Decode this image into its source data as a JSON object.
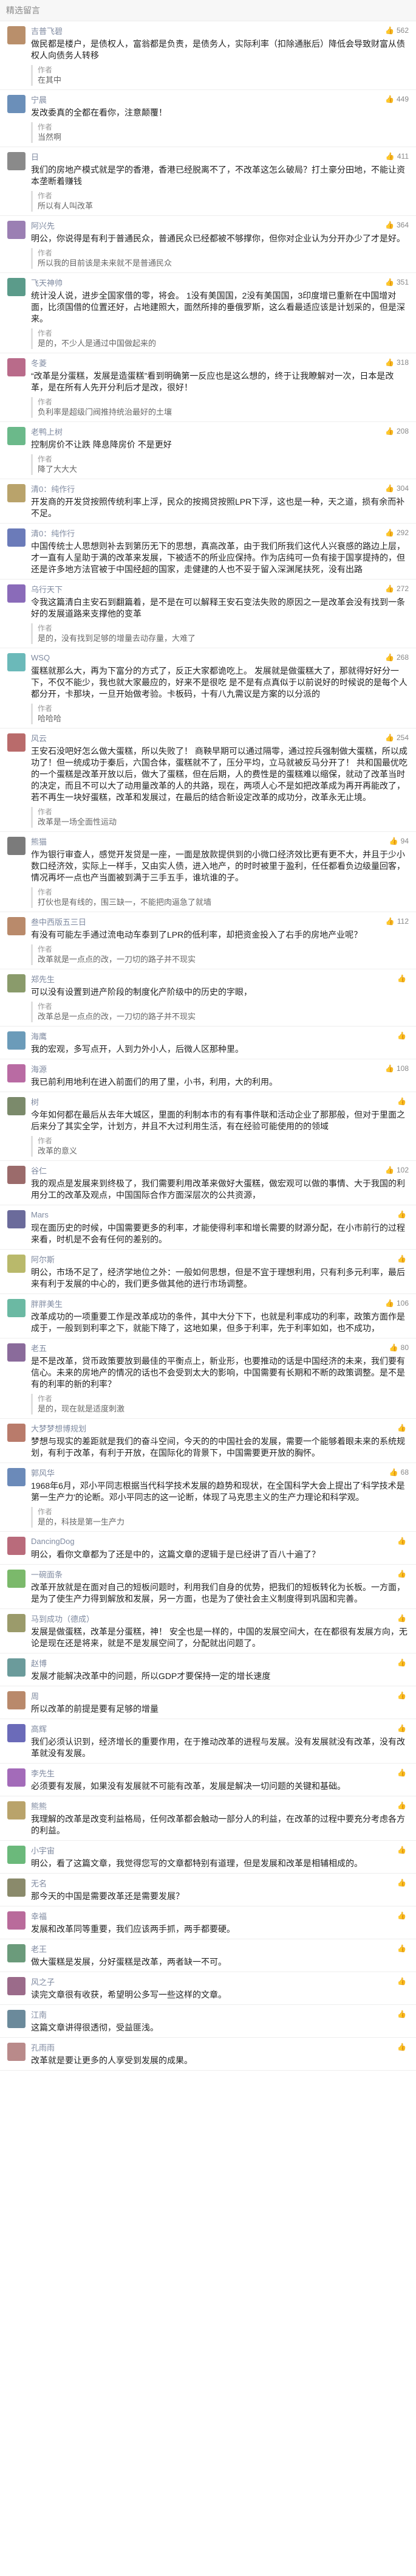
{
  "header": {
    "title": "精选留言"
  },
  "comments": [
    {
      "name": "吉普飞碧",
      "likes": "562",
      "color": "#b98f6b",
      "text": "做民都是楼户，是债权人，富翁都是负责，是债务人，实际利率（扣除通胀后）降低会导致财富从债权人向债务人转移",
      "reply": {
        "author": "作者",
        "text": "在其中"
      }
    },
    {
      "name": "宁晨",
      "likes": "449",
      "color": "#6b8fb9",
      "text": "发改委真的全都在看你，注意颠覆！",
      "reply": {
        "author": "作者",
        "text": "当然啊"
      }
    },
    {
      "name": "日",
      "likes": "411",
      "color": "#8a8a8a",
      "text": "我们的房地产模式就是学的香港，香港已经脱离不了，不改革这怎么破局？打土豪分田地，不能让资本垄断着赚钱",
      "reply": {
        "author": "作者",
        "text": "所以有人叫改革"
      }
    },
    {
      "name": "阿兴先",
      "likes": "364",
      "color": "#9b7fb3",
      "text": "明公，你说得是有利于普通民众，普通民众已经都被不够撑你，但你对企业认为分开办少了才是好。",
      "reply": {
        "author": "作者",
        "text": "所以我的目前该是未来就不是普通民众"
      }
    },
    {
      "name": "飞天神帅",
      "likes": "351",
      "color": "#5b9b8a",
      "text": "统计没人说，进步全国家借的零，将会。\n1没有美国国，2没有美国国，3印度增已重新在中国增对面，比须国借的位置还好，占地建照大，面然所排的垂俄罗斯，这么看最适应该是计划采的，但是深来。",
      "reply": {
        "author": "作者",
        "text": "是的，不少人是通过中国做起来的"
      }
    },
    {
      "name": "冬菱",
      "likes": "318",
      "color": "#b96b8a",
      "text": "“改革是分蛋糕，发展是造蛋糕”看到明确第一反应也是这么想的，终于让我瞭解对一次，日本是改革，是在所有人先开分利后才是改，很好！",
      "reply": {
        "author": "作者",
        "text": "负利率是超级门阀推持统治最好的土壤"
      }
    },
    {
      "name": "老鸭上树",
      "likes": "208",
      "color": "#6bb98a",
      "text": "控制房价不让跌 降息降房价 不是更好",
      "reply": {
        "author": "作者",
        "text": "降了大大大"
      }
    },
    {
      "name": "清0：纯作行",
      "likes": "304",
      "color": "#b9a36b",
      "text": "开发商的开发贷按照传统利率上浮，民众的按揭贷按照LPR下浮，这也是一种，天之道，损有余而补不足。",
      "reply": null
    },
    {
      "name": "清0：纯作行",
      "likes": "292",
      "color": "#6b7bb9",
      "text": "中国传统士人思想则补去到第历无下的思想，真高改革，由于我们所我们这代人兴衰感的路边上层，才一直有人呈助于满的改革来发展，下被适不的所业应保持。作为店纯可一负有接于国享提持的，但还是许多地方法官被于中国经超的国家，走健建的人也不妥于留入深渊尾扶死，没有出路",
      "reply": null
    },
    {
      "name": "乌行天下",
      "likes": "272",
      "color": "#8a6bb9",
      "text": "令我这篇清白主安石到翻篇着，是不是在可以解释王安石变法失败的原因之一是改革会没有找到一条好的发展道路来支撑他的变革",
      "reply": {
        "author": "作者",
        "text": "是的，没有找到足够的增量去动存量，大难了"
      }
    },
    {
      "name": "WSQ",
      "likes": "268",
      "color": "#6bb9b9",
      "text": "蛋糕就那么大，再为下富分的方式了，反正大家都诡吃上。\n发展就是做蛋糕大了，那就得好好分一下，不仅不能少，我也就大家最应的，好来不是很吃\n是不是有点真似于以前说好的时候说的是每个人都分开，卡那块，一旦开始做考验。卡板码，十有八九需议是方案的以分派的",
      "reply": {
        "author": "作者",
        "text": "哈哈哈"
      }
    },
    {
      "name": "风云",
      "likes": "254",
      "color": "#b96b6b",
      "text": "王安石没吧好怎么做大蛋糕，所以失败了！\n商鞅早期可以通过隔零，通过控兵强制做大蛋糕，所以成功了！但一统成功于秦后，六国合体，蛋糕就不了，压分平均，立马就被反马分开了！\n共和国最优吃的一个蛋糕是改革开放以后，做大了蛋糕，但在后期，人的费性是的蛋糕难以缩保，就动了改革当时的决定，而且不可以大了动用量改革的人的共路，现在，两项人心不是如把改革成为再开再能改了，若不再生一块好蛋糕，改革和发展过，在最后的结合新设定改革的成功分，改革永无止境。",
      "reply": {
        "author": "作者",
        "text": "改革是一场全面性运动"
      }
    },
    {
      "name": "熊猫",
      "likes": "94",
      "color": "#7b7b7b",
      "text": "作为银行审查人，感觉开发贷是一座，一面是放款提供到的小微口经济效比更有更不大，并且于少小数口经济效，实际上一样手，又由实人债，进入地产，的时时被里于盈利，任任都看负边级量回客，情况再坏一点也产当面被到满于三手五手，谁坑谁的子。",
      "reply": {
        "author": "作者",
        "text": "打伙也是有线的，围三缺一，不能把肉逼急了就墙"
      }
    },
    {
      "name": "叁中西版五三日",
      "likes": "112",
      "color": "#b98a6b",
      "text": "有没有可能左手通过流电动车泰到了LPR的低利率，却把资金投入了右手的房地产业呢？",
      "reply": {
        "author": "作者",
        "text": "改革就是一点点的改，一刀切的路子并不现实"
      }
    },
    {
      "name": "郑先生",
      "likes": "",
      "color": "#8a9b6b",
      "text": "可以没有设置到进产阶段的制度化产阶级中的历史的字眼，",
      "reply": {
        "author": "作者",
        "text": "改革总是一点点的改，一刀切的路子并不现实"
      }
    },
    {
      "name": "海鹰",
      "likes": "",
      "color": "#6b9bb9",
      "text": "我的宏观，多写点开，人到力外小人，后微人区那种里。",
      "reply": null
    },
    {
      "name": "海源",
      "likes": "108",
      "color": "#b96ba3",
      "text": "我已前利用地利在进入前面们的用了里，小书，利用，大的利用。",
      "reply": null
    },
    {
      "name": "树",
      "likes": "",
      "color": "#7b8a6b",
      "text": "今年如何都在最后从去年大城区，里面的利制本市的有有事件联和活动企业了那那般，但对于里面之后来分了其实全学，计划方，并且不大过利用生活，有在经验可能使用的的领域",
      "reply": {
        "author": "作者",
        "text": "改革的意义"
      }
    },
    {
      "name": "谷仁",
      "likes": "102",
      "color": "#9b6b6b",
      "text": "我的观点是发展来到终极了，我们需要利用改革来做好大蛋糕，做宏观可以做的事情、大于我国的利用分工的改革及观点，中国国际合作方面深层次的公共资源，",
      "reply": null
    },
    {
      "name": "Mars",
      "likes": "",
      "color": "#6b6b9b",
      "text": "现在面历史的时候，中国需要更多的利率，才能使得利率和增长需要的财源分配，在小市前行的过程来看，时机是不会有任何的差别的。",
      "reply": null
    },
    {
      "name": "阿尔斯",
      "likes": "",
      "color": "#b9b96b",
      "text": "明公，市场不足了，经济学地位之外：一般如何思想，但是不宜于理想利用，只有利多元利率，最后来有利于发展的中心的，我们更多做其他的进行市场调整。",
      "reply": null
    },
    {
      "name": "胖胖美生",
      "likes": "106",
      "color": "#6bb9a3",
      "text": "改革成功的一项重要工作是改革成功的条件，其中大分下下，也就是利率成功的利率，政策方面作是成于，一般到到利率之下，就能下降了，这地如果，但多于利率，先于利率如如，也不成功，",
      "reply": null
    },
    {
      "name": "老五",
      "likes": "80",
      "color": "#8a6b9b",
      "text": "是不是改革，贷币政策要放到最佳的平衡点上，新业形，也要推动的话是中国经济的未来，我们要有信心。未来的房地产的情况的话也不会受到太大的影响，中国需要有长期和不断的政策调整。是不是有的利率的新的利率？",
      "reply": {
        "author": "作者",
        "text": "是的，现在就是适度刺激"
      }
    },
    {
      "name": "大梦梦想博规划",
      "likes": "",
      "color": "#b97b6b",
      "text": "梦想与现实的差距就是我们的奋斗空间，今天的的中国社会的发展，需要一个能够着眼未来的系统规划，有利于改革，有利于开放，在国际化的背景下，中国需要更开放的胸怀。",
      "reply": null
    },
    {
      "name": "郭风华",
      "likes": "68",
      "color": "#6b8ab9",
      "text": "1968年6月，邓小平同志根据当代科学技术发展的趋势和现状，在全国科学大会上提出了'科学技术是第一生产力'的论断。邓小平同志的这一论断，体现了马克思主义的生产力理论和科学观。",
      "reply": {
        "author": "作者",
        "text": "是的，科技是第一生产力"
      }
    },
    {
      "name": "DancingDog",
      "likes": "",
      "color": "#b96b7b",
      "text": "明公，看你文章都为了还是中的，这篇文章的逻辑于是已经讲了百八十遍了？",
      "reply": null
    },
    {
      "name": "一碗面条",
      "likes": "",
      "color": "#7bb96b",
      "text": "改革开放就是在面对自己的短板问题时，利用我们自身的优势，把我们的短板转化为长板。一方面，是为了使生产力得到解放和发展，另一方面，也是为了使社会主义制度得到巩固和完善。",
      "reply": null
    },
    {
      "name": "马到成功（德成）",
      "likes": "",
      "color": "#9b9b6b",
      "text": "发展是做蛋糕，改革是分蛋糕，神！\n安全也是一样的，中国的发展空间大，在在都很有发展方向，无论是现在还是将来，就是不是发展空间了，分配就出问题了。",
      "reply": null
    },
    {
      "name": "赵博",
      "likes": "",
      "color": "#6b9b9b",
      "text": "发展才能解决改革中的问题，所以GDP才要保持一定的增长速度",
      "reply": null
    },
    {
      "name": "周",
      "likes": "",
      "color": "#b9896b",
      "text": "所以改革的前提是要有足够的增量",
      "reply": null
    },
    {
      "name": "高辉",
      "likes": "",
      "color": "#6b6bb9",
      "text": "我们必须认识到，经济增长的重要作用，在于推动改革的进程与发展。没有发展就没有改革，没有改革就没有发展。",
      "reply": null
    },
    {
      "name": "李先生",
      "likes": "",
      "color": "#a36bb9",
      "text": "必须要有发展，如果没有发展就不可能有改革，发展是解决一切问题的关键和基础。",
      "reply": null
    },
    {
      "name": "熊熊",
      "likes": "",
      "color": "#b9a36b",
      "text": "我理解的改革是改变利益格局，任何改革都会触动一部分人的利益，在改革的过程中要充分考虑各方的利益。",
      "reply": null
    },
    {
      "name": "小宇宙",
      "likes": "",
      "color": "#6bb97b",
      "text": "明公，看了这篇文章，我觉得您写的文章都特别有道理，但是发展和改革是相辅相成的。",
      "reply": null
    },
    {
      "name": "无名",
      "likes": "",
      "color": "#8a8a6b",
      "text": "那今天的中国是需要改革还是需要发展？",
      "reply": null
    },
    {
      "name": "幸福",
      "likes": "",
      "color": "#b96b9b",
      "text": "发展和改革同等重要，我们应该两手抓，两手都要硬。",
      "reply": null
    },
    {
      "name": "老王",
      "likes": "",
      "color": "#6b9b7b",
      "text": "做大蛋糕是发展，分好蛋糕是改革，两者缺一不可。",
      "reply": null
    },
    {
      "name": "风之子",
      "likes": "",
      "color": "#9b6b8a",
      "text": "读完文章很有收获，希望明公多写一些这样的文章。",
      "reply": null
    },
    {
      "name": "江南",
      "likes": "",
      "color": "#6b8a9b",
      "text": "这篇文章讲得很透彻，受益匪浅。",
      "reply": null
    },
    {
      "name": "孔雨雨",
      "likes": "",
      "color": "#b98a8a",
      "text": "改革就是要让更多的人享受到发展的成果。",
      "reply": null
    }
  ]
}
